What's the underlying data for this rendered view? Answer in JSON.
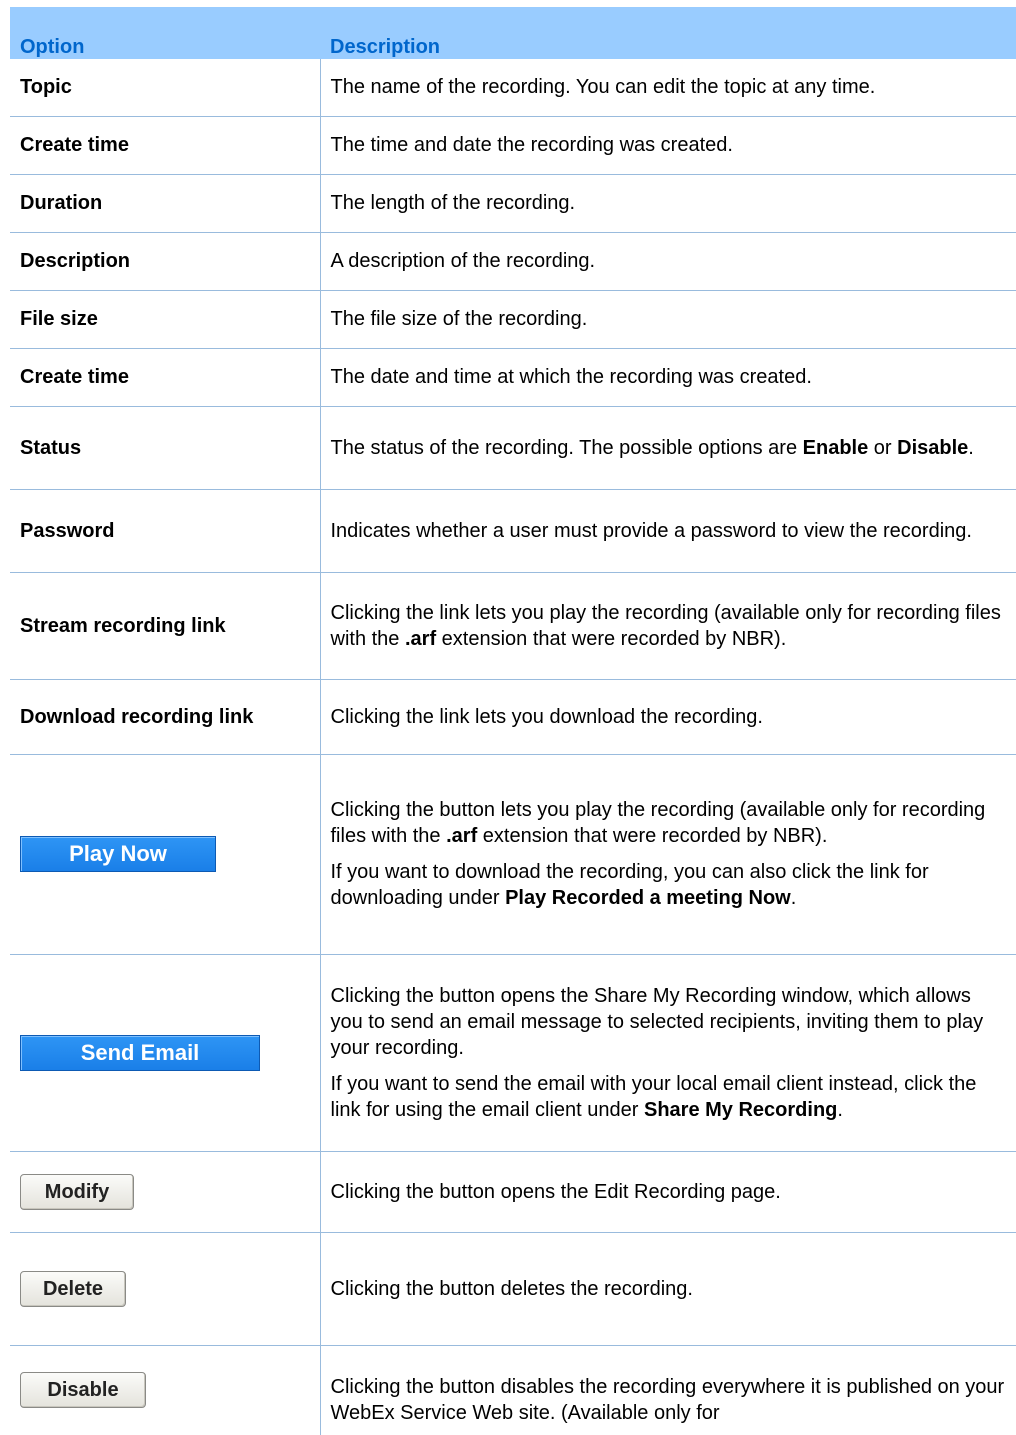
{
  "header": {
    "option": "Option",
    "description": "Description"
  },
  "rows": [
    {
      "option": "Topic",
      "desc": "The name of the recording. You can edit the topic at any time."
    },
    {
      "option": "Create time",
      "desc": "The time and date the recording was created."
    },
    {
      "option": "Duration",
      "desc": "The length of the recording."
    },
    {
      "option": "Description",
      "desc": "A description of the recording."
    },
    {
      "option": "File size",
      "desc": "The file size of the recording."
    },
    {
      "option": "Create time",
      "desc": "The date and time at which the recording was created."
    },
    {
      "option": "Status",
      "desc_a": "The status of the recording. The possible options are ",
      "desc_b1": "Enable",
      "desc_mid": " or ",
      "desc_b2": "Disable",
      "desc_end": "."
    },
    {
      "option": "Password",
      "desc": "Indicates whether a user must provide a password to view the recording."
    },
    {
      "option": "Stream recording link",
      "desc_a": "Clicking the link lets you play the recording (available only for recording files with the ",
      "desc_b": ".arf",
      "desc_c": " extension that were recorded by NBR)."
    },
    {
      "option": "Download recording link",
      "desc": "Clicking the link lets you download the recording."
    },
    {
      "button": "Play Now",
      "p1_a": "Clicking the button lets you play the recording (available only for recording files with the ",
      "p1_b": ".arf",
      "p1_c": " extension that were recorded by NBR).",
      "p2_a": "If you want to download the recording, you can also click the link for downloading under ",
      "p2_b": "Play Recorded a meeting Now",
      "p2_c": "."
    },
    {
      "button": "Send Email",
      "p1": "Clicking the button opens the Share My Recording window, which allows you to send an email message to selected recipients, inviting them to play your recording.",
      "p2_a": "If you want to send the email with your local email client instead, click the link for using the email client under ",
      "p2_b": "Share My Recording",
      "p2_c": "."
    },
    {
      "button": "Modify",
      "desc": "Clicking the button opens the Edit Recording page."
    },
    {
      "button": "Delete",
      "desc": "Clicking the button deletes the recording."
    },
    {
      "button": "Disable",
      "desc": "Clicking the button disables the recording everywhere it is published on your WebEx Service Web site. (Available only for"
    }
  ],
  "colors": {
    "header_bg": "#99ccff",
    "header_text": "#0066cc",
    "blue_button": "#1a7fe8",
    "rule": "#99bbdd"
  }
}
